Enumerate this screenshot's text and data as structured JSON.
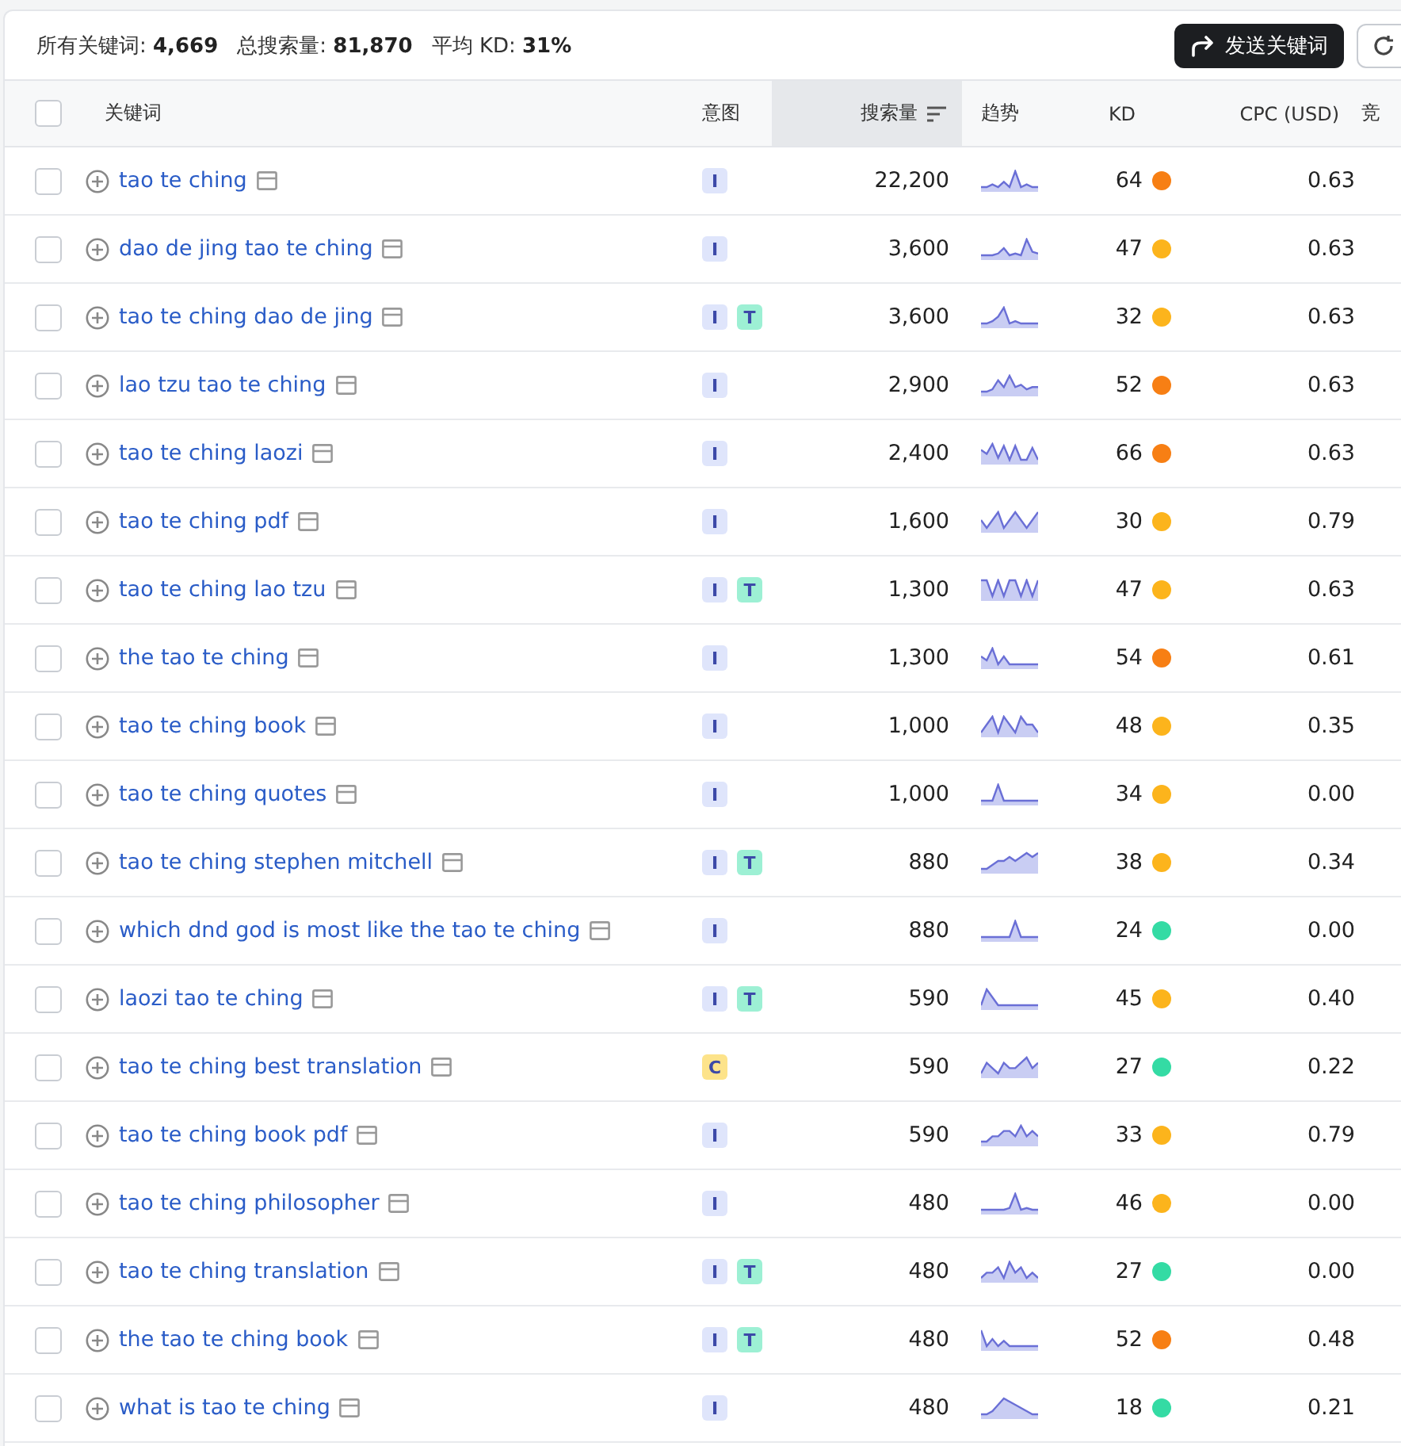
{
  "summary": [
    "所有关键词: **4,669**",
    "总搜索量: **81,870**",
    "平均 KD: **31%**"
  ],
  "send_button": "发送关键词",
  "table": {
    "select_all": {
      "checked": false
    },
    "columns": [
      {
        "label": "关键词",
        "sorted": false
      },
      {
        "label": "意图",
        "sorted": false
      },
      {
        "label": "搜索量",
        "sorted": true
      },
      {
        "label": "趋势",
        "sorted": false
      },
      {
        "label": "KD",
        "sorted": false
      },
      {
        "label": "CPC (USD)",
        "sorted": false
      },
      {
        "label": "竞",
        "sorted": false
      }
    ],
    "rows": [
      {
        "checked": false,
        "keyword": "tao te ching",
        "intents": [
          {
            "label": "I",
            "color": "#dfe5fb"
          }
        ],
        "volume": "22,200",
        "kd": "64",
        "color": "#f77f14",
        "cpc": "0.63"
      },
      {
        "checked": false,
        "keyword": "dao de jing tao te ching",
        "intents": [
          {
            "label": "I",
            "color": "#dfe5fb"
          }
        ],
        "volume": "3,600",
        "kd": "47",
        "color": "#fcb41c",
        "cpc": "0.63"
      },
      {
        "checked": false,
        "keyword": "tao te ching dao de jing",
        "intents": [
          {
            "label": "I",
            "color": "#dfe5fb"
          },
          {
            "label": "T",
            "color": "#9df0d4"
          }
        ],
        "volume": "3,600",
        "kd": "32",
        "color": "#fcb41c",
        "cpc": "0.63"
      },
      {
        "checked": false,
        "keyword": "lao tzu tao te ching",
        "intents": [
          {
            "label": "I",
            "color": "#dfe5fb"
          }
        ],
        "volume": "2,900",
        "kd": "52",
        "color": "#f77f14",
        "cpc": "0.63"
      },
      {
        "checked": false,
        "keyword": "tao te ching laozi",
        "intents": [
          {
            "label": "I",
            "color": "#dfe5fb"
          }
        ],
        "volume": "2,400",
        "kd": "66",
        "color": "#f77f14",
        "cpc": "0.63"
      },
      {
        "checked": false,
        "keyword": "tao te ching pdf",
        "intents": [
          {
            "label": "I",
            "color": "#dfe5fb"
          }
        ],
        "volume": "1,600",
        "kd": "30",
        "color": "#fcb41c",
        "cpc": "0.79"
      },
      {
        "checked": false,
        "keyword": "tao te ching lao tzu",
        "intents": [
          {
            "label": "I",
            "color": "#dfe5fb"
          },
          {
            "label": "T",
            "color": "#9df0d4"
          }
        ],
        "volume": "1,300",
        "kd": "47",
        "color": "#fcb41c",
        "cpc": "0.63"
      },
      {
        "checked": false,
        "keyword": "the tao te ching",
        "intents": [
          {
            "label": "I",
            "color": "#dfe5fb"
          }
        ],
        "volume": "1,300",
        "kd": "54",
        "color": "#f77f14",
        "cpc": "0.61"
      },
      {
        "checked": false,
        "keyword": "tao te ching book",
        "intents": [
          {
            "label": "I",
            "color": "#dfe5fb"
          }
        ],
        "volume": "1,000",
        "kd": "48",
        "color": "#fcb41c",
        "cpc": "0.35"
      },
      {
        "checked": false,
        "keyword": "tao te ching quotes",
        "intents": [
          {
            "label": "I",
            "color": "#dfe5fb"
          }
        ],
        "volume": "1,000",
        "kd": "34",
        "color": "#fcb41c",
        "cpc": "0.00"
      },
      {
        "checked": false,
        "keyword": "tao te ching stephen mitchell",
        "intents": [
          {
            "label": "I",
            "color": "#dfe5fb"
          },
          {
            "label": "T",
            "color": "#9df0d4"
          }
        ],
        "volume": "880",
        "kd": "38",
        "color": "#fcb41c",
        "cpc": "0.34"
      },
      {
        "checked": false,
        "keyword": "which dnd god is most like the tao te ching",
        "intents": [
          {
            "label": "I",
            "color": "#dfe5fb"
          }
        ],
        "volume": "880",
        "kd": "24",
        "color": "#34dba4",
        "cpc": "0.00"
      },
      {
        "checked": false,
        "keyword": "laozi tao te ching",
        "intents": [
          {
            "label": "I",
            "color": "#dfe5fb"
          },
          {
            "label": "T",
            "color": "#9df0d4"
          }
        ],
        "volume": "590",
        "kd": "45",
        "color": "#fcb41c",
        "cpc": "0.40"
      },
      {
        "checked": false,
        "keyword": "tao te ching best translation",
        "intents": [
          {
            "label": "C",
            "color": "#fde38a"
          }
        ],
        "volume": "590",
        "kd": "27",
        "color": "#34dba4",
        "cpc": "0.22"
      },
      {
        "checked": false,
        "keyword": "tao te ching book pdf",
        "intents": [
          {
            "label": "I",
            "color": "#dfe5fb"
          }
        ],
        "volume": "590",
        "kd": "33",
        "color": "#fcb41c",
        "cpc": "0.79"
      },
      {
        "checked": false,
        "keyword": "tao te ching philosopher",
        "intents": [
          {
            "label": "I",
            "color": "#dfe5fb"
          }
        ],
        "volume": "480",
        "kd": "46",
        "color": "#fcb41c",
        "cpc": "0.00"
      },
      {
        "checked": false,
        "keyword": "tao te ching translation",
        "intents": [
          {
            "label": "I",
            "color": "#dfe5fb"
          },
          {
            "label": "T",
            "color": "#9df0d4"
          }
        ],
        "volume": "480",
        "kd": "27",
        "color": "#34dba4",
        "cpc": "0.00"
      },
      {
        "checked": false,
        "keyword": "the tao te ching book",
        "intents": [
          {
            "label": "I",
            "color": "#dfe5fb"
          },
          {
            "label": "T",
            "color": "#9df0d4"
          }
        ],
        "volume": "480",
        "kd": "52",
        "color": "#f77f14",
        "cpc": "0.48"
      },
      {
        "checked": false,
        "keyword": "what is tao te ching",
        "intents": [
          {
            "label": "I",
            "color": "#dfe5fb"
          }
        ],
        "volume": "480",
        "kd": "18",
        "color": "#34dba4",
        "cpc": "0.21"
      }
    ]
  }
}
